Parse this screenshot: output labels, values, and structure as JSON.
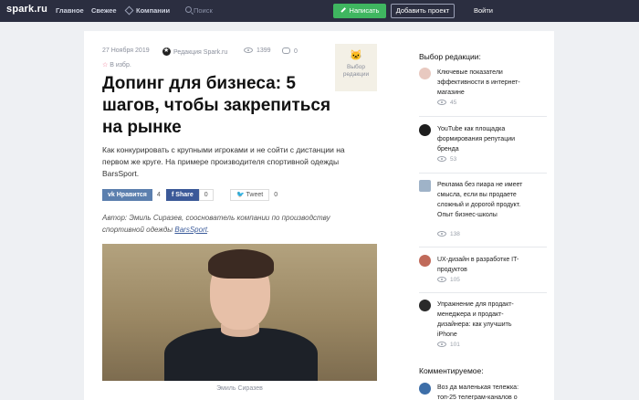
{
  "brand": {
    "logo": "spark.ru"
  },
  "nav": {
    "home": "Главное",
    "fresh": "Свежее",
    "companies": "Компании"
  },
  "search": {
    "placeholder": "Поиск"
  },
  "actions": {
    "write": "Написать",
    "add_project": "Добавить проект",
    "login": "Войти"
  },
  "article": {
    "date": "27 Ноября 2019",
    "author_label": "Редакция Spark.ru",
    "views": "1399",
    "comments": "0",
    "favorite": "В избр.",
    "badge_text": "Выбор редакции",
    "title": "Допинг для бизнеса: 5 шагов, чтобы закрепиться на рынке",
    "lead": "Как конкурировать с крупными игроками и не сойти с дистанции на первом же круге. На примере производителя спортивной одежды BarsSport.",
    "share": {
      "vk_label": "Нравится",
      "vk_count": "4",
      "fb_label": "Share",
      "fb_count": "0",
      "tw_label": "Tweet",
      "tw_count": "0"
    },
    "author_note": "Автор: Эмиль Сиразев, сооснователь компании по производству спортивной одежды ",
    "author_link": "BarsSport",
    "author_tail": ".",
    "photo_caption": "Эмиль Сиразев"
  },
  "sidebar": {
    "editors_title": "Выбор редакции:",
    "items": [
      {
        "text": "Ключевые показатели эффективности в интернет-магазине",
        "views": "45"
      },
      {
        "text": "YouTube как площадка формирования репутации бренда",
        "views": "53"
      },
      {
        "text": "Реклама без пиара не имеет смысла, если вы продаете сложный и дорогой продукт. Опыт бизнес-школы",
        "views": "138"
      },
      {
        "text": "UX-дизайн в разработке IT-продуктов",
        "views": "105"
      },
      {
        "text": "Упражнение для продакт-менеджера и продакт-дизайнера: как улучшить iPhone",
        "views": "101"
      }
    ],
    "commented_title": "Комментируемое:",
    "commented": [
      {
        "text": "Воз да маленькая тележка: топ-25 телеграм-каналов о"
      }
    ]
  },
  "colors": {
    "topbar": "#2b2e40",
    "write_button": "#3fb660",
    "vk": "#5b7fae",
    "facebook": "#3b5998",
    "twitter": "#55acee"
  }
}
